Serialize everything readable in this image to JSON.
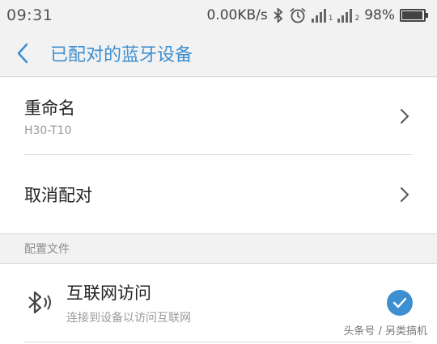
{
  "status_bar": {
    "time": "09:31",
    "net_speed": "0.00KB/s",
    "sim1_label": "1",
    "sim2_label": "2",
    "battery": "98%",
    "battery_level": 0.98,
    "icons": [
      "bluetooth-icon",
      "alarm-icon",
      "signal-icon",
      "battery-icon"
    ]
  },
  "header": {
    "title": "已配对的蓝牙设备"
  },
  "settings": {
    "rename": {
      "label": "重命名",
      "value": "H30-T10"
    },
    "unpair": {
      "label": "取消配对"
    }
  },
  "profiles": {
    "header": "配置文件",
    "items": [
      {
        "label": "互联网访问",
        "description": "连接到设备以访问互联网",
        "checked": true
      }
    ]
  },
  "watermark": "头条号 / 另类搞机",
  "colors": {
    "accent": "#3d8fd1",
    "background": "#f2f2f2",
    "card": "#ffffff"
  }
}
